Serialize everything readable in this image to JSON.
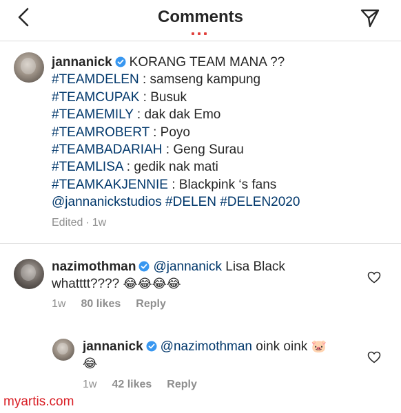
{
  "header": {
    "title": "Comments",
    "back_icon": "chevron-left-icon",
    "share_icon": "paper-plane-icon"
  },
  "colors": {
    "accent_dots": "#e0413d",
    "link": "#00376b",
    "meta_gray": "#8e8e8e",
    "verified_blue": "#3897f0",
    "watermark": "#d91f26"
  },
  "caption": {
    "username": "jannanick",
    "lines": [
      {
        "tag": "",
        "text": "KORANG TEAM MANA ??"
      },
      {
        "tag": "#TEAMDELEN",
        "text": " : samseng kampung"
      },
      {
        "tag": "#TEAMCUPAK",
        "text": " : Busuk"
      },
      {
        "tag": "#TEAMEMILY",
        "text": " : dak dak Emo"
      },
      {
        "tag": "#TEAMROBERT",
        "text": " : Poyo"
      },
      {
        "tag": "#TEAMBADARIAH",
        "text": " : Geng Surau"
      },
      {
        "tag": "#TEAMLISA",
        "text": " : gedik nak mati"
      },
      {
        "tag": "#TEAMKAKJENNIE",
        "text": " : Blackpink ‘s fans"
      }
    ],
    "last_line": "@jannanickstudios #DELEN #DELEN2020",
    "meta": {
      "edited": "Edited",
      "sep": "·",
      "time": "1w"
    }
  },
  "comment1": {
    "username": "nazimothman",
    "mention": "@jannanick",
    "text1": " Lisa Black",
    "text2": "whatttt????",
    "emojis": "😂😂😂😂",
    "time": "1w",
    "likes": "80 likes",
    "reply": "Reply"
  },
  "comment2": {
    "username": "jannanick",
    "mention": "@nazimothman",
    "text1": " oink oink ",
    "emoji1": "🐷",
    "emoji2": "😂",
    "time": "1w",
    "likes": "42 likes",
    "reply": "Reply"
  },
  "watermark": "myartis.com"
}
